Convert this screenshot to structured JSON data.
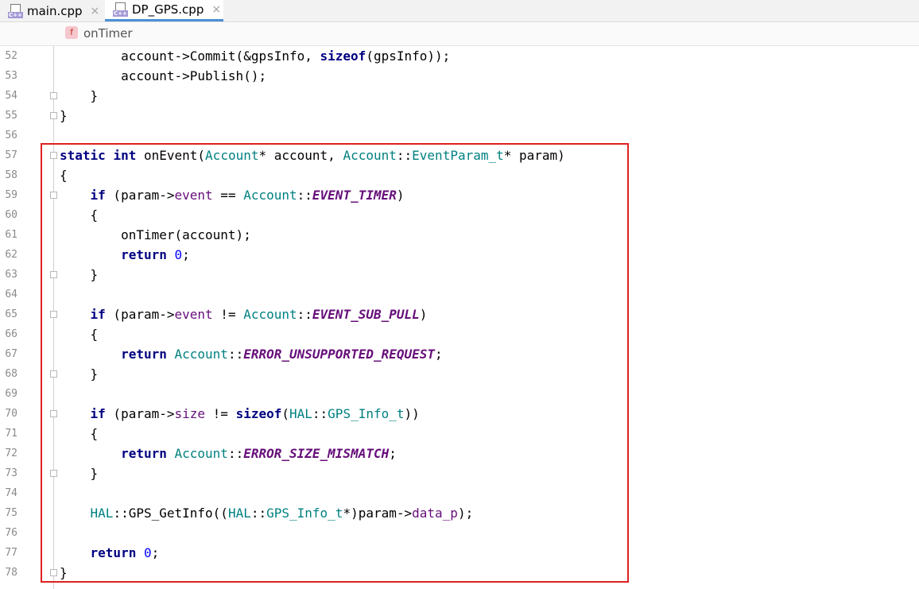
{
  "tabs": [
    {
      "label": "main.cpp",
      "icon": "cpp-file-icon",
      "close": "×",
      "active": false
    },
    {
      "label": "DP_GPS.cpp",
      "icon": "cpp-file-icon",
      "close": "×",
      "active": true
    }
  ],
  "file_icon_text": "C++",
  "breadcrumb": {
    "icon_letter": "f",
    "label": "onTimer"
  },
  "colors": {
    "keyword": "#000080",
    "type": "#008080",
    "field": "#660e7a",
    "number": "#0000ff",
    "highlight_border": "#e02020",
    "active_tab_underline": "#4a90d9"
  },
  "lines": [
    {
      "n": "52",
      "code": "        account->Commit(&gpsInfo, sizeof(gpsInfo));"
    },
    {
      "n": "53",
      "code": "        account->Publish();"
    },
    {
      "n": "54",
      "code": "    }"
    },
    {
      "n": "55",
      "code": "}"
    },
    {
      "n": "56",
      "code": ""
    },
    {
      "n": "57",
      "code": "static int onEvent(Account* account, Account::EventParam_t* param)"
    },
    {
      "n": "58",
      "code": "{"
    },
    {
      "n": "59",
      "code": "    if (param->event == Account::EVENT_TIMER)"
    },
    {
      "n": "60",
      "code": "    {"
    },
    {
      "n": "61",
      "code": "        onTimer(account);"
    },
    {
      "n": "62",
      "code": "        return 0;"
    },
    {
      "n": "63",
      "code": "    }"
    },
    {
      "n": "64",
      "code": ""
    },
    {
      "n": "65",
      "code": "    if (param->event != Account::EVENT_SUB_PULL)"
    },
    {
      "n": "66",
      "code": "    {"
    },
    {
      "n": "67",
      "code": "        return Account::ERROR_UNSUPPORTED_REQUEST;"
    },
    {
      "n": "68",
      "code": "    }"
    },
    {
      "n": "69",
      "code": ""
    },
    {
      "n": "70",
      "code": "    if (param->size != sizeof(HAL::GPS_Info_t))"
    },
    {
      "n": "71",
      "code": "    {"
    },
    {
      "n": "72",
      "code": "        return Account::ERROR_SIZE_MISMATCH;"
    },
    {
      "n": "73",
      "code": "    }"
    },
    {
      "n": "74",
      "code": ""
    },
    {
      "n": "75",
      "code": "    HAL::GPS_GetInfo((HAL::GPS_Info_t*)param->data_p);"
    },
    {
      "n": "76",
      "code": ""
    },
    {
      "n": "77",
      "code": "    return 0;"
    },
    {
      "n": "78",
      "code": "}"
    }
  ]
}
